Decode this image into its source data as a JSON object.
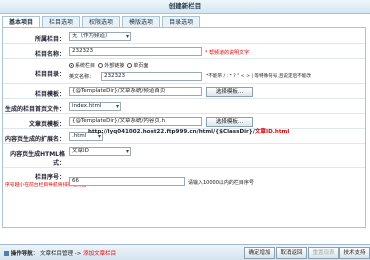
{
  "window": {
    "title": "创建新栏目"
  },
  "tabs": [
    {
      "label": "基本项目"
    },
    {
      "label": "栏目选项"
    },
    {
      "label": "权限选项"
    },
    {
      "label": "模版选项"
    },
    {
      "label": "目录选项"
    }
  ],
  "form": {
    "parent": {
      "label": "所属栏目：",
      "value": "无（作为频道）"
    },
    "name": {
      "label": "栏目名称：",
      "value": "232323",
      "hint": "* 帮频道的说明文字"
    },
    "dir": {
      "label": "栏目目录：",
      "radio1": "系统栏目",
      "radio2": "外部链接",
      "radio3": "单页面",
      "prefix": "英文名称：",
      "value": "232323",
      "hint": "*不能带 / : * ? \" < > | 等特殊符号,且说定后不能改"
    },
    "template": {
      "label": "栏目模板：",
      "value": "{@TemplateDir}/文章系统/频道首页",
      "btn": "选择模板..."
    },
    "index_file": {
      "label": "生成的栏目首页文件：",
      "value": "index.html"
    },
    "content_tpl": {
      "label": "文章页模板：",
      "value": "{@TemplateDir}/文章系统/内容页.h",
      "btn": "选择模板..."
    },
    "ext": {
      "label": "内容页生成的扩展名：",
      "value": ".html"
    },
    "rule": {
      "label": "内容页生成HTML格式：",
      "value": "文章ID"
    },
    "url": {
      "prefix": "http://lyq041002.host22.ftp999.cn/html/{$ClassDir}/",
      "suffix": "文章ID.html"
    },
    "order": {
      "label": "栏目序号：",
      "hint": "序号越小在前台栏目导航将排得越前面",
      "value": "66",
      "help": "请输入10000以内的栏目序号"
    }
  },
  "status": {
    "icon_label": "操作导航",
    "crumb1": "文章栏目管理",
    "crumb2": "添加文章栏目",
    "buttons": [
      "确定增加",
      "取消返回",
      "重置现表",
      "技术支持"
    ]
  }
}
